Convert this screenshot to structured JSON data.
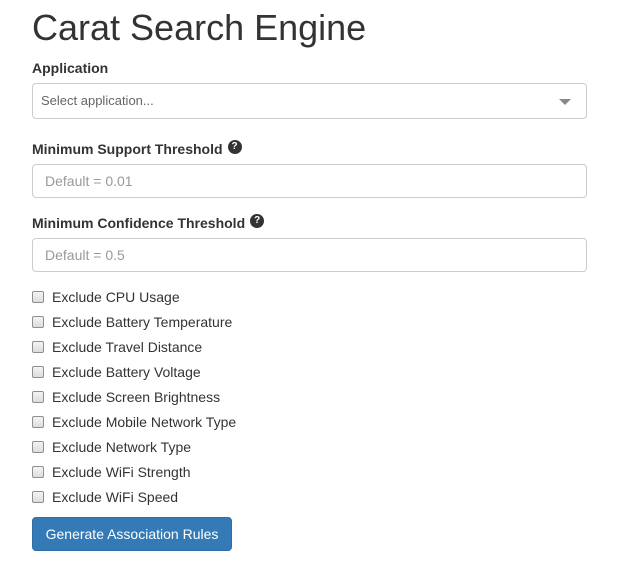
{
  "page": {
    "title": "Carat Search Engine"
  },
  "application": {
    "label": "Application",
    "placeholder": "Select application..."
  },
  "support": {
    "label": "Minimum Support Threshold",
    "placeholder": "Default = 0.01",
    "value": ""
  },
  "confidence": {
    "label": "Minimum Confidence Threshold",
    "placeholder": "Default = 0.5",
    "value": ""
  },
  "help_icon": {
    "glyph": "?",
    "name": "question-circle-icon"
  },
  "exclusions": [
    {
      "label": "Exclude CPU Usage",
      "checked": false
    },
    {
      "label": "Exclude Battery Temperature",
      "checked": false
    },
    {
      "label": "Exclude Travel Distance",
      "checked": false
    },
    {
      "label": "Exclude Battery Voltage",
      "checked": false
    },
    {
      "label": "Exclude Screen Brightness",
      "checked": false
    },
    {
      "label": "Exclude Mobile Network Type",
      "checked": false
    },
    {
      "label": "Exclude Network Type",
      "checked": false
    },
    {
      "label": "Exclude WiFi Strength",
      "checked": false
    },
    {
      "label": "Exclude WiFi Speed",
      "checked": false
    }
  ],
  "submit": {
    "label": "Generate Association Rules"
  },
  "colors": {
    "text": "#333333",
    "primary": "#337ab7",
    "primary_border": "#2e6da4",
    "input_border": "#cccccc"
  }
}
